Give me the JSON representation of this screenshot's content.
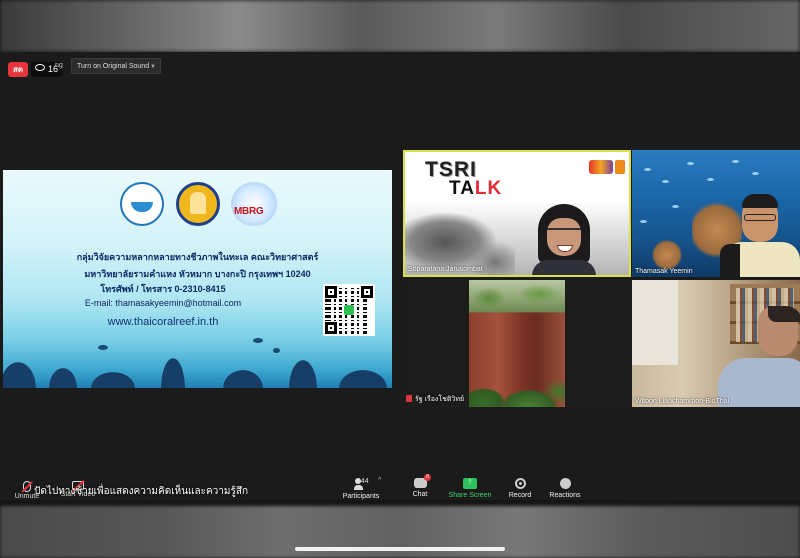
{
  "live": {
    "badge": "สด",
    "viewers": "16",
    "fragment": "ng"
  },
  "audio": {
    "original_sound_label": "Turn on Original Sound"
  },
  "slide": {
    "logo_text": "MBRG",
    "line1": "กลุ่มวิจัยความหลากหลายทางชีวภาพในทะเล คณะวิทยาศาสตร์",
    "line2": "มหาวิทยาลัยรามคำแหง หัวหมาก บางกะปิ กรุงเทพฯ 10240",
    "line3": "โทรศัพท์ / โทรสาร 0-2310-8415",
    "email": "E-mail: thamasakyeemin@hotmail.com",
    "website": "www.thaicoralreef.in.th"
  },
  "participants_video": [
    {
      "name": "Soparatana Jarusombat",
      "active_speaker": true,
      "title_a": "TSRI",
      "title_b": "TA",
      "title_c": "LK"
    },
    {
      "name": "Thamasak Yeemin"
    },
    {
      "name": "รัฐ เรืองโชติวิทย์",
      "muted": true
    },
    {
      "name": "Witoon Lianchamroon-BioThai"
    }
  ],
  "toolbar": {
    "unmute": "Unmute",
    "start_video": "Start Video",
    "participants": "Participants",
    "participants_count": "144",
    "chat": "Chat",
    "chat_badge": "8",
    "share_screen": "Share Screen",
    "record": "Record",
    "reactions": "Reactions"
  },
  "comment_prompt": "ปัดไปทางซ้ายเพื่อแสดงความคิดเห็นและความรู้สึก",
  "colors": {
    "live_badge": "#e8343c",
    "active_border": "#d7e24a",
    "share_screen": "#2dc25e"
  }
}
